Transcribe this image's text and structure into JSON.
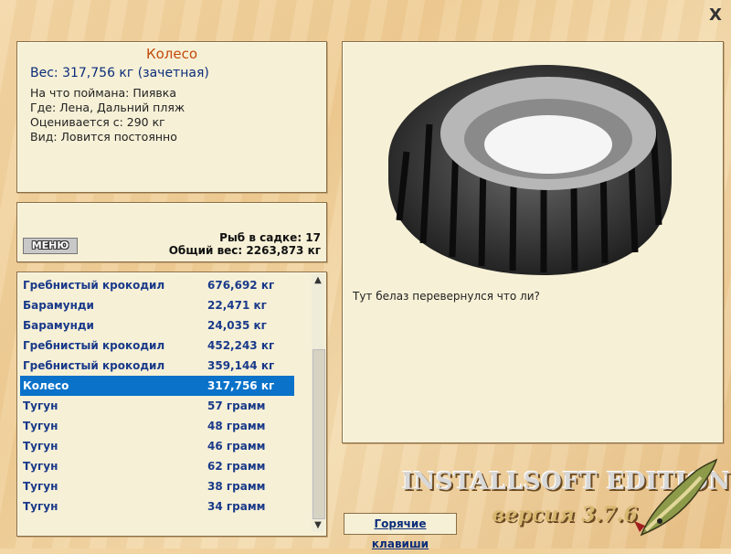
{
  "window": {
    "close_symbol": "X"
  },
  "info": {
    "title": "Колесо",
    "weight": "Вес: 317,756 кг (зачетная)",
    "bait": "На что поймана: Пиявка",
    "where": "Где: Лена, Дальний пляж",
    "valued": "Оценивается с: 290 кг",
    "kind": "Вид: Ловится постоянно"
  },
  "summary": {
    "menu_label": "МЕНЮ",
    "fish_in_cage": "Рыб в садке: 17",
    "total_weight": "Общий вес: 2263,873 кг"
  },
  "list": {
    "rows": [
      {
        "name": "Гребнистый крокодил",
        "weight": "676,692 кг"
      },
      {
        "name": "Барамунди",
        "weight": "22,471 кг"
      },
      {
        "name": "Барамунди",
        "weight": "24,035 кг"
      },
      {
        "name": "Гребнистый крокодил",
        "weight": "452,243 кг"
      },
      {
        "name": "Гребнистый крокодил",
        "weight": "359,144 кг"
      },
      {
        "name": "Колесо",
        "weight": "317,756 кг",
        "selected": true
      },
      {
        "name": "Тугун",
        "weight": "57 грамм"
      },
      {
        "name": "Тугун",
        "weight": "48 грамм"
      },
      {
        "name": "Тугун",
        "weight": "46 грамм"
      },
      {
        "name": "Тугун",
        "weight": "62 грамм"
      },
      {
        "name": "Тугун",
        "weight": "38 грамм"
      },
      {
        "name": "Тугун",
        "weight": "34 грамм"
      }
    ],
    "selected_color": "#0a72c9"
  },
  "picture": {
    "caption": "Тут белаз перевернулся что ли?",
    "image": "tire-image"
  },
  "brand": {
    "edition": "INSTALLSOFT EDITION",
    "version": "версия 3.7.6"
  },
  "hotkeys": {
    "label": "Горячие клавиши"
  }
}
